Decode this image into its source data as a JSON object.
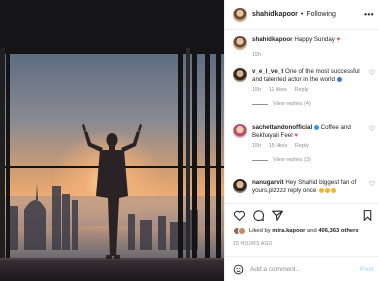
{
  "post": {
    "author": "shahidkapoor",
    "follow_label": "Following",
    "more_label": "•••",
    "caption": {
      "username": "shahidkapoor",
      "text": "Happy Sunday",
      "time": "15h"
    }
  },
  "comments": [
    {
      "username": "v_e_l_ve_t",
      "text": "One of the most successful and talented actor in the world",
      "time": "15h",
      "likes": "11 likes",
      "reply_label": "Reply",
      "view_replies": "View replies (4)"
    },
    {
      "username": "sachettandonofficial",
      "text": "Coffee and Bekhayali Feel",
      "time": "15h",
      "likes": "15 likes",
      "reply_label": "Reply",
      "view_replies": "View replies (3)"
    },
    {
      "username": "nanugarvit",
      "text": "Hey Shahid biggest fan of yours,plzzzz reply once"
    }
  ],
  "likes": {
    "prefix": "Liked by",
    "user": "mira.kapoor",
    "joiner": "and",
    "count": "406,363 others"
  },
  "timestamp": "15 HOURS AGO",
  "comment_box": {
    "placeholder": "Add a comment...",
    "post_label": "Post"
  },
  "colors": {
    "accent_blue": "#0095f6",
    "heart_red": "#ed4956",
    "muted_text": "#8e8e8e"
  }
}
